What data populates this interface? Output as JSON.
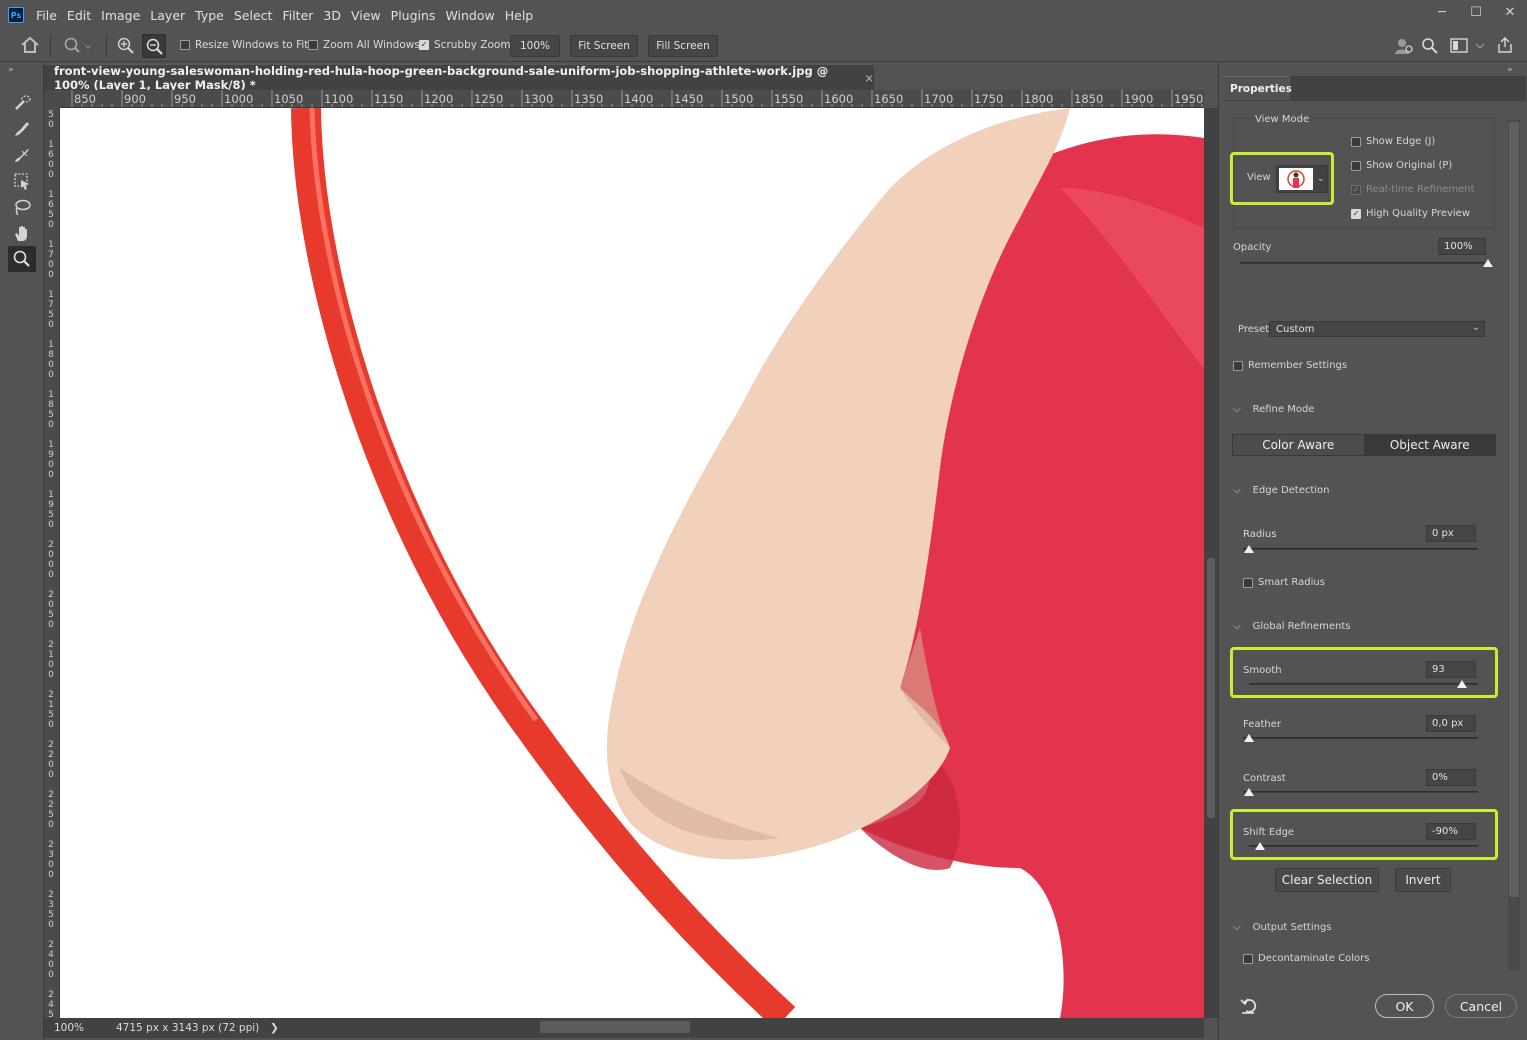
{
  "menu": {
    "logo": "Ps",
    "items": [
      "File",
      "Edit",
      "Image",
      "Layer",
      "Type",
      "Select",
      "Filter",
      "3D",
      "View",
      "Plugins",
      "Window",
      "Help"
    ]
  },
  "window_controls": {
    "minimize": "─",
    "maximize": "☐",
    "close": "✕"
  },
  "options_bar": {
    "resize_windows": "Resize Windows to Fit",
    "zoom_all": "Zoom All Windows",
    "scrubby_zoom": "Scrubby Zoom",
    "zoom_value": "100%",
    "fit_screen": "Fit Screen",
    "fill_screen": "Fill Screen"
  },
  "document": {
    "tab_title": "front-view-young-saleswoman-holding-red-hula-hoop-green-background-sale-uniform-job-shopping-athlete-work.jpg @ 100% (Layer 1, Layer Mask/8) *",
    "close": "×"
  },
  "ruler_h": [
    "850",
    "900",
    "950",
    "1000",
    "1050",
    "1100",
    "1150",
    "1200",
    "1250",
    "1300",
    "1350",
    "1400",
    "1450",
    "1500",
    "1550",
    "1600",
    "1650",
    "1700",
    "1750",
    "1800",
    "1850",
    "1900",
    "1950"
  ],
  "ruler_v": [
    "50",
    "1600",
    "1650",
    "1700",
    "1750",
    "1800",
    "1850",
    "1900",
    "1950",
    "2000",
    "2050",
    "2100",
    "2150",
    "2200",
    "2250",
    "2300",
    "2350",
    "2400",
    "2450"
  ],
  "status": {
    "zoom": "100%",
    "dimensions": "4715 px x 3143 px (72 ppi)",
    "arrow": "❯"
  },
  "properties": {
    "tab": "Properties",
    "view_mode": {
      "title": "View Mode",
      "view_label": "View",
      "show_edge": "Show Edge (J)",
      "show_original": "Show Original (P)",
      "realtime": "Real-time Refinement",
      "hq_preview": "High Quality Preview"
    },
    "opacity": {
      "label": "Opacity",
      "value": "100%",
      "level": 1.0
    },
    "preset": {
      "label": "Preset",
      "value": "Custom"
    },
    "remember": "Remember Settings",
    "refine_mode": {
      "title": "Refine Mode",
      "color_aware": "Color Aware",
      "object_aware": "Object Aware"
    },
    "edge_detection": {
      "title": "Edge Detection",
      "radius_label": "Radius",
      "radius_value": "0 px",
      "smart_radius": "Smart Radius"
    },
    "global": {
      "title": "Global Refinements",
      "smooth_label": "Smooth",
      "smooth_value": "93",
      "feather_label": "Feather",
      "feather_value": "0,0 px",
      "contrast_label": "Contrast",
      "contrast_value": "0%",
      "shift_label": "Shift Edge",
      "shift_value": "-90%"
    },
    "clear_selection": "Clear Selection",
    "invert": "Invert",
    "output": {
      "title": "Output Settings",
      "decontaminate": "Decontaminate Colors"
    },
    "ok": "OK",
    "cancel": "Cancel"
  },
  "colors": {
    "highlight": "#c6f036",
    "hoop": "#e83a2c",
    "shirt": "#e2344d",
    "skin": "#f1d0bc"
  }
}
